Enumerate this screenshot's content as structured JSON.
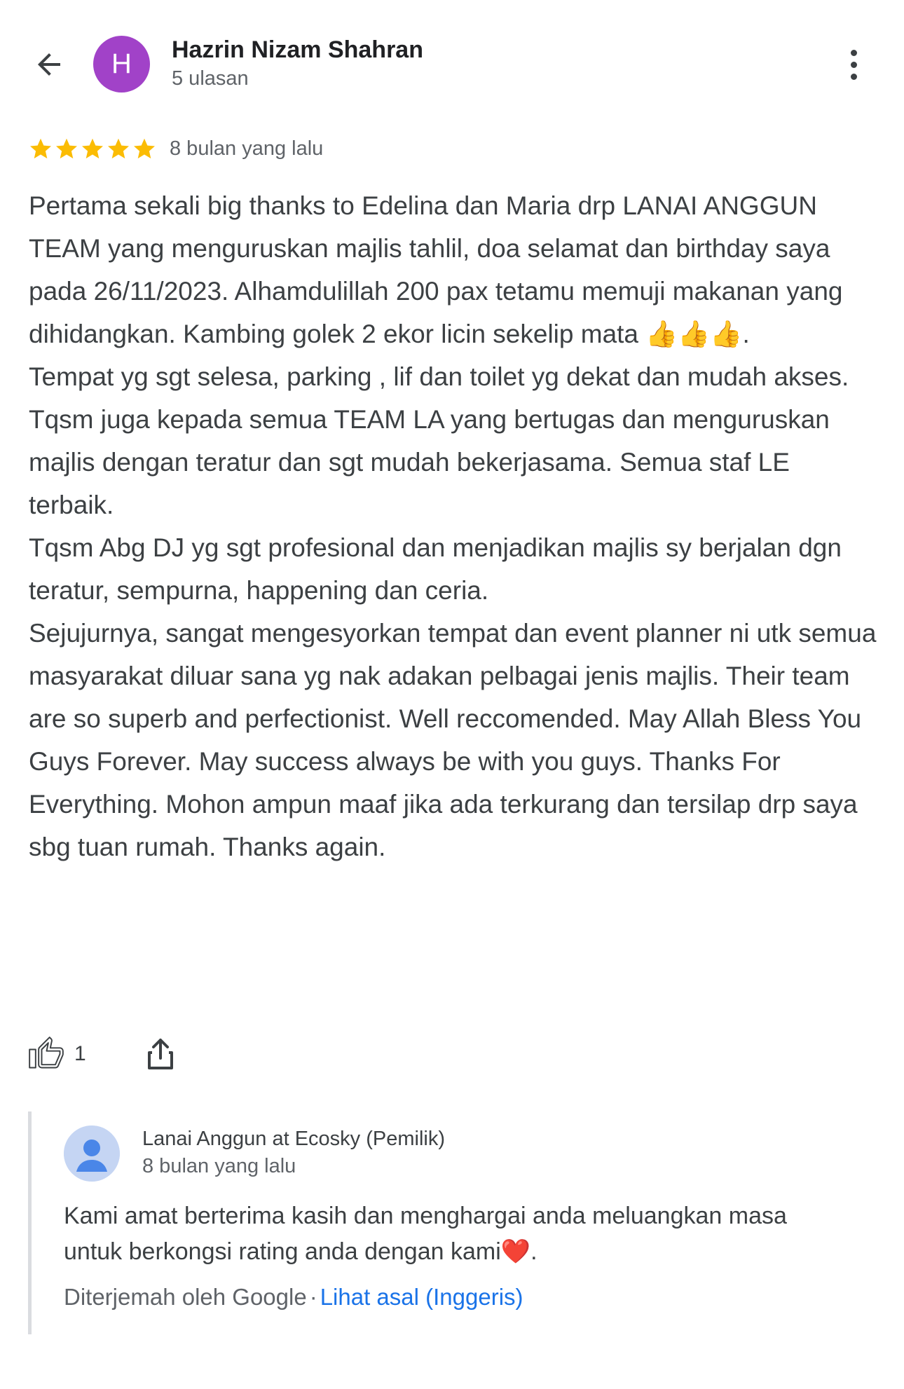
{
  "header": {
    "avatar_letter": "H",
    "avatar_color": "#a142c8",
    "reviewer_name": "Hazrin Nizam Shahran",
    "review_count": "5 ulasan"
  },
  "review": {
    "rating": 5,
    "max_rating": 5,
    "star_color": "#fbbc04",
    "time_ago": "8 bulan yang lalu",
    "text": "Pertama sekali big thanks to Edelina dan Maria drp LANAI ANGGUN TEAM yang menguruskan majlis tahlil, doa selamat dan birthday saya pada 26/11/2023. Alhamdulillah 200 pax tetamu memuji makanan yang dihidangkan. Kambing golek 2 ekor licin sekelip mata 👍👍👍.\nTempat yg sgt selesa, parking , lif dan toilet yg dekat dan mudah akses.\nTqsm juga kepada semua TEAM LA yang bertugas dan menguruskan majlis dengan teratur dan sgt mudah bekerjasama. Semua staf LE terbaik.\nTqsm Abg DJ yg sgt profesional dan menjadikan majlis sy berjalan dgn teratur, sempurna, happening dan ceria.\nSejujurnya, sangat mengesyorkan tempat dan event planner ni utk semua masyarakat diluar sana yg nak adakan pelbagai jenis majlis. Their team are so superb and perfectionist. Well reccomended. May Allah Bless You Guys Forever. May success always be with you guys. Thanks For Everything. Mohon ampun maaf jika ada terkurang dan tersilap drp saya sbg tuan rumah. Thanks again."
  },
  "actions": {
    "like_count": "1"
  },
  "owner_reply": {
    "name": "Lanai Anggun at Ecosky (Pemilik)",
    "time_ago": "8 bulan yang lalu",
    "text": "Kami amat berterima kasih dan menghargai anda meluangkan masa untuk berkongsi rating anda dengan kami❤️.",
    "translated_by": "Diterjemah oleh Google",
    "separator": "·",
    "view_original": "Lihat asal (Inggeris)",
    "link_color": "#1a73e8"
  }
}
